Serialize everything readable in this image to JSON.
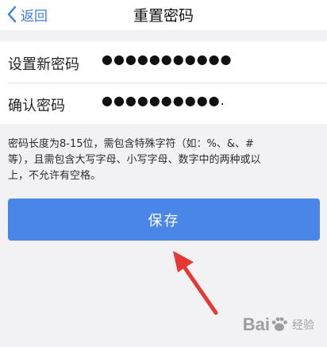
{
  "navbar": {
    "back_label": "返回",
    "title": "重置密码"
  },
  "form": {
    "new_password_label": "设置新密码",
    "new_password_value": "●●●●●●●●●●●",
    "confirm_password_label": "确认密码",
    "confirm_password_value": "●●●●●●●●●●."
  },
  "hint_text": "密码长度为8-15位，需包含特殊字符（如：%、&、#等），且需包含大写字母、小写字母、数字中的两种或以上，不允许有空格。",
  "save_label": "保存",
  "watermark": {
    "text_left": "Bai",
    "text_right": "经验",
    "brand": "Baidu 经验"
  },
  "colors": {
    "accent": "#4a86e8",
    "back_link": "#3b7ddd",
    "arrow": "#e53935",
    "background": "#f2f2f4"
  },
  "icons": {
    "back": "chevron-left-icon",
    "arrow": "red-arrow-annotation-icon",
    "watermark": "baidu-paw-icon"
  }
}
